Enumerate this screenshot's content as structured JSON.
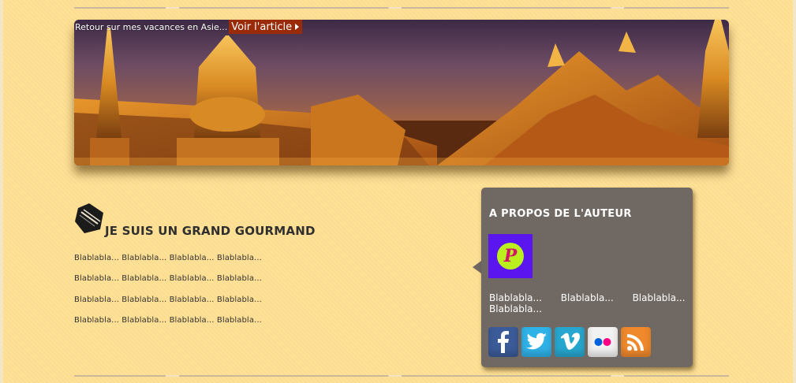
{
  "banner": {
    "caption": "Retour sur mes vacances en Asie...",
    "read_more": "Voir l'article"
  },
  "post": {
    "title": "JE SUIS UN GRAND GOURMAND",
    "lines": [
      "Blablabla... Blablabla... Blablabla... Blablabla...",
      "Blablabla... Blablabla... Blablabla... Blablabla...",
      "Blablabla... Blablabla... Blablabla... Blablabla...",
      "Blablabla... Blablabla... Blablabla... Blablabla..."
    ]
  },
  "about": {
    "title": "A PROPOS DE L'AUTEUR",
    "avatar_letter": "P",
    "bio": "Blablabla... Blablabla... Blablabla... Blablabla...",
    "socials": [
      {
        "icon": "facebook-icon",
        "color": "#3b5b98"
      },
      {
        "icon": "twitter-icon",
        "color": "#2fb2e8"
      },
      {
        "icon": "vimeo-icon",
        "color": "#27a7cf"
      },
      {
        "icon": "flickr-icon",
        "color": "#f2f2f2"
      },
      {
        "icon": "rss-icon",
        "color": "#f0892b"
      }
    ]
  },
  "colors": {
    "background": "#ffe092",
    "panel": "#706862",
    "accent": "#9a2b08"
  }
}
